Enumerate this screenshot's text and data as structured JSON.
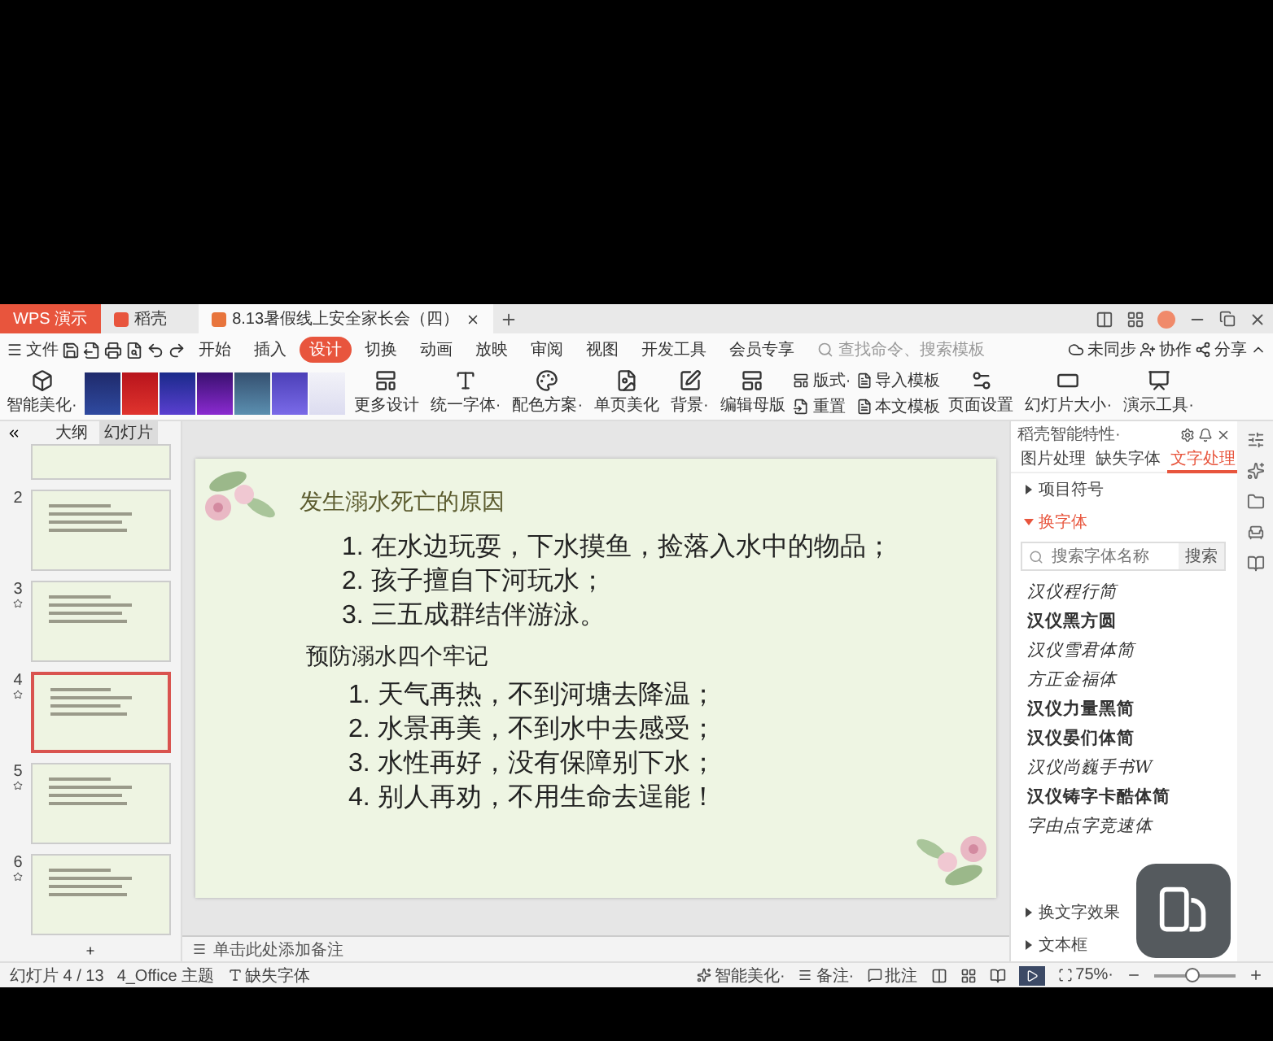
{
  "title_bar": {
    "app_tab": "WPS 演示",
    "tabs": [
      {
        "label": "稻壳",
        "selected": false
      },
      {
        "label": "8.13暑假线上安全家长会（四）",
        "selected": true
      }
    ]
  },
  "menu_bar": {
    "file": "文件",
    "tabs": [
      {
        "label": "开始",
        "selected": false
      },
      {
        "label": "插入",
        "selected": false
      },
      {
        "label": "设计",
        "selected": true
      },
      {
        "label": "切换",
        "selected": false
      },
      {
        "label": "动画",
        "selected": false
      },
      {
        "label": "放映",
        "selected": false
      },
      {
        "label": "审阅",
        "selected": false
      },
      {
        "label": "视图",
        "selected": false
      },
      {
        "label": "开发工具",
        "selected": false
      },
      {
        "label": "会员专享",
        "selected": false
      }
    ],
    "search": {
      "placeholder": "查找命令、搜索模板"
    },
    "actions": [
      "未同步",
      "协作",
      "分享"
    ]
  },
  "ribbon": {
    "smart": "智能美化·",
    "more": "更多设计",
    "tools": [
      {
        "kind": "large",
        "label": "统一字体·"
      },
      {
        "kind": "large",
        "label": "配色方案·"
      },
      {
        "kind": "large",
        "label": "单页美化"
      },
      {
        "kind": "large",
        "label": "背景·"
      },
      {
        "kind": "large",
        "label": "编辑母版"
      },
      {
        "kind": "pair",
        "labels": [
          "版式·",
          "重置"
        ]
      },
      {
        "kind": "pair",
        "labels": [
          "导入模板",
          "本文模板"
        ]
      },
      {
        "kind": "large",
        "label": "页面设置"
      },
      {
        "kind": "large",
        "label": "幻灯片大小·"
      },
      {
        "kind": "large",
        "label": "演示工具·"
      }
    ]
  },
  "slide_panel": {
    "tabs": [
      {
        "label": "大纲",
        "selected": false
      },
      {
        "label": "幻灯片",
        "selected": true
      }
    ],
    "slides": [
      {
        "selected": false
      },
      {
        "number": "2",
        "selected": false,
        "animated": false
      },
      {
        "number": "3",
        "selected": false,
        "animated": true
      },
      {
        "number": "4",
        "selected": true,
        "animated": true
      },
      {
        "number": "5",
        "selected": false,
        "animated": true
      },
      {
        "number": "6",
        "selected": false,
        "animated": true
      }
    ]
  },
  "slide": {
    "title": "发生溺水死亡的原因",
    "causes": [
      "1. 在水边玩耍，下水摸鱼，捡落入水中的物品；",
      "2. 孩子擅自下河玩水；",
      "3. 三五成群结伴游泳。"
    ],
    "subtitle": "预防溺水四个牢记",
    "rules": [
      "1. 天气再热，不到河塘去降温；",
      "2. 水景再美，不到水中去感受；",
      "3. 水性再好，没有保障别下水；",
      "4. 别人再劝，不用生命去逞能！"
    ]
  },
  "notes": {
    "placeholder": "单击此处添加备注"
  },
  "side_pane": {
    "title": "稻壳智能特性·",
    "tabs": [
      {
        "label": "图片处理",
        "selected": false
      },
      {
        "label": "缺失字体",
        "selected": false
      },
      {
        "label": "文字处理",
        "selected": true
      }
    ],
    "sections_top": [
      {
        "label": "项目符号",
        "expanded": false
      },
      {
        "label": "换字体",
        "expanded": true
      }
    ],
    "search": {
      "placeholder": "搜索字体名称",
      "button": "搜索"
    },
    "fonts": [
      {
        "name": "汉仪程行简",
        "kind": "script"
      },
      {
        "name": "汉仪黑方圆",
        "kind": "heavy"
      },
      {
        "name": "汉仪雪君体简",
        "kind": "script"
      },
      {
        "name": "方正金福体",
        "kind": "script"
      },
      {
        "name": "汉仪力量黑简",
        "kind": "heavy"
      },
      {
        "name": "汉仪晏们体简",
        "kind": "heavy"
      },
      {
        "name": "汉仪尚巍手书W",
        "kind": "script"
      },
      {
        "name": "汉仪铸字卡酷体简",
        "kind": "heavy"
      },
      {
        "name": "字由点字竞速体",
        "kind": "script"
      }
    ],
    "sections_bottom": [
      {
        "label": "换文字效果",
        "expanded": false
      },
      {
        "label": "文本框",
        "expanded": false
      }
    ]
  },
  "status_bar": {
    "slide_count": "幻灯片 4 / 13",
    "theme": "4_Office 主题",
    "missing_font": "缺失字体",
    "beautify": "智能美化·",
    "notes": "备注·",
    "comments": "批注",
    "zoom": "75%·",
    "zoom_slider": {
      "level": 0.45
    }
  }
}
